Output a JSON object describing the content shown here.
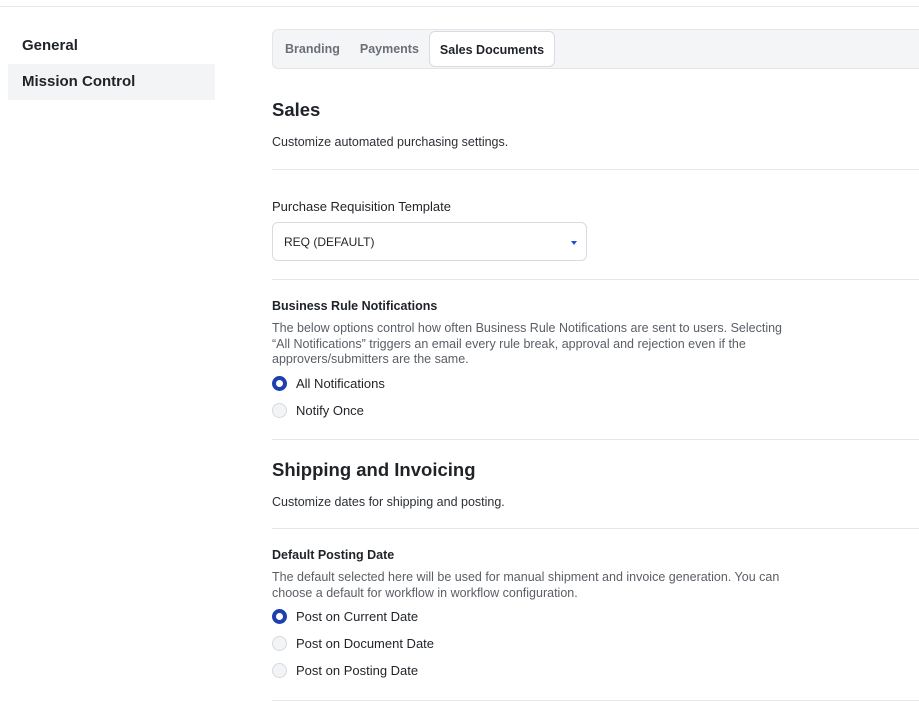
{
  "sidebar": {
    "items": [
      {
        "label": "General"
      },
      {
        "label": "Mission Control"
      }
    ]
  },
  "tabs": [
    {
      "label": "Branding"
    },
    {
      "label": "Payments"
    },
    {
      "label": "Sales Documents"
    }
  ],
  "sales": {
    "title": "Sales",
    "description": "Customize automated purchasing settings.",
    "requisition": {
      "label": "Purchase Requisition Template",
      "value": "REQ (DEFAULT)"
    },
    "notifications": {
      "label": "Business Rule Notifications",
      "help_lines": [
        "The below options control how often Business Rule Notifications are sent to users. Selecting",
        "“All Notifications” triggers an email every rule break, approval and rejection even if the",
        "approvers/submitters are the same."
      ],
      "options": [
        {
          "label": "All Notifications",
          "selected": true
        },
        {
          "label": "Notify Once",
          "selected": false
        }
      ]
    }
  },
  "shipping": {
    "title": "Shipping and Invoicing",
    "description": "Customize dates for shipping and posting.",
    "posting": {
      "label": "Default Posting Date",
      "help_lines": [
        "The default selected here will be used for manual shipment and invoice generation. You can",
        "choose a default for workflow in workflow configuration."
      ],
      "options": [
        {
          "label": "Post on Current Date",
          "selected": true
        },
        {
          "label": "Post on Document Date",
          "selected": false
        },
        {
          "label": "Post on Posting Date",
          "selected": false
        }
      ]
    }
  },
  "colors": {
    "accent": "#1e40af",
    "sidebar_active_bg": "#f3f4f6"
  }
}
